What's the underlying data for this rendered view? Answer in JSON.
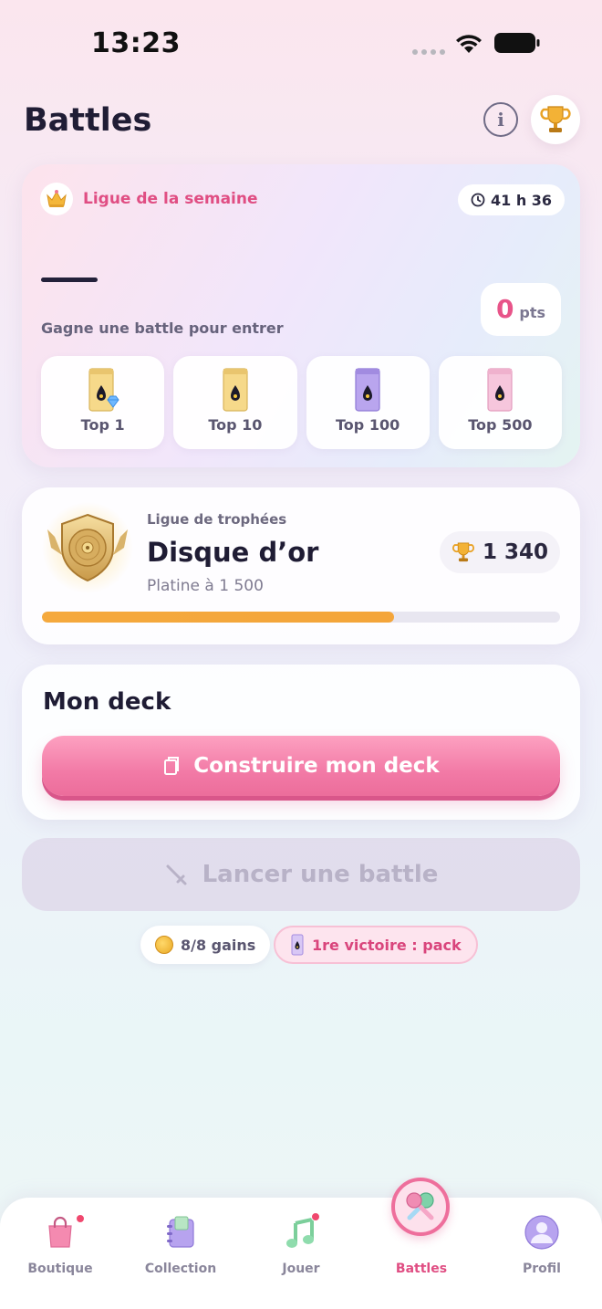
{
  "status_bar": {
    "time": "13:23"
  },
  "header": {
    "title": "Battles"
  },
  "weekly_league": {
    "title": "Ligue de la semaine",
    "timer": "41 h 36",
    "hint": "Gagne une battle pour entrer",
    "points_value": "0",
    "points_unit": "pts",
    "rewards": [
      {
        "label": "Top 1",
        "pack_color": "gold"
      },
      {
        "label": "Top 10",
        "pack_color": "gold"
      },
      {
        "label": "Top 100",
        "pack_color": "purple"
      },
      {
        "label": "Top 500",
        "pack_color": "pink"
      }
    ]
  },
  "trophy_league": {
    "label": "Ligue de trophées",
    "name": "Disque d’or",
    "next_tier": "Platine à 1 500",
    "trophies": "1 340",
    "progress_fraction": 0.68
  },
  "deck": {
    "title": "Mon deck",
    "build_label": "Construire mon deck"
  },
  "launch": {
    "label": "Lancer une battle"
  },
  "chips": {
    "gains": "8/8 gains",
    "first_win": "1re victoire : pack"
  },
  "tabs": [
    {
      "label": "Boutique",
      "icon": "shopping-bag-icon",
      "badge": true
    },
    {
      "label": "Collection",
      "icon": "binder-icon",
      "badge": false
    },
    {
      "label": "Jouer",
      "icon": "music-note-icon",
      "badge": true
    },
    {
      "label": "Battles",
      "icon": "microphones-icon",
      "active": true
    },
    {
      "label": "Profil",
      "icon": "profile-icon",
      "badge": false
    }
  ],
  "colors": {
    "accent_pink": "#e04e83",
    "progress_orange": "#f5a93d",
    "button_pink": "#f27aa6"
  }
}
